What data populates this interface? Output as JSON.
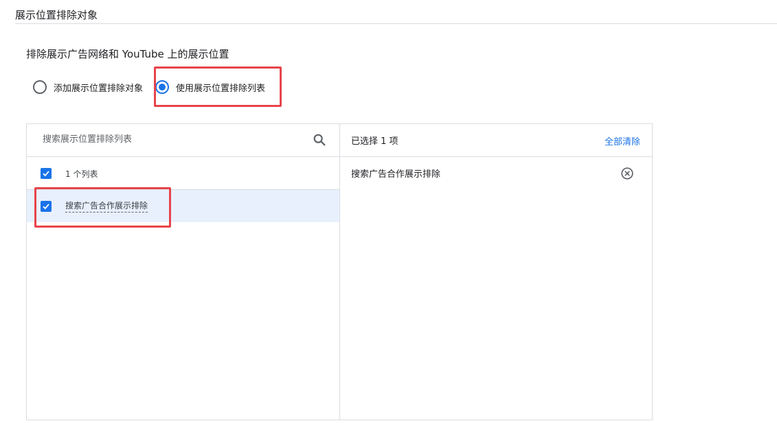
{
  "section": {
    "title": "展示位置排除对象"
  },
  "exclusion": {
    "heading": "排除展示广告网络和 YouTube 上的展示位置",
    "options": [
      {
        "label": "添加展示位置排除对象",
        "selected": false
      },
      {
        "label": "使用展示位置排除列表",
        "selected": true
      }
    ]
  },
  "picker": {
    "search_placeholder": "搜索展示位置排除列表",
    "search_value": "",
    "list_header": {
      "label": "1 个列表",
      "checked": true
    },
    "items": [
      {
        "label": "搜索广告合作展示排除",
        "checked": true
      }
    ],
    "selected_panel": {
      "count_label": "已选择 1 项",
      "clear_all_label": "全部清除",
      "items": [
        {
          "label": "搜索广告合作展示排除"
        }
      ]
    }
  },
  "icons": {
    "search": "search-icon",
    "remove": "close-circle-icon",
    "check": "check-icon"
  },
  "colors": {
    "accent": "#1a73e8",
    "highlight": "#e8434b",
    "selected_row_bg": "#e8f0fe",
    "border": "#dadce0"
  }
}
